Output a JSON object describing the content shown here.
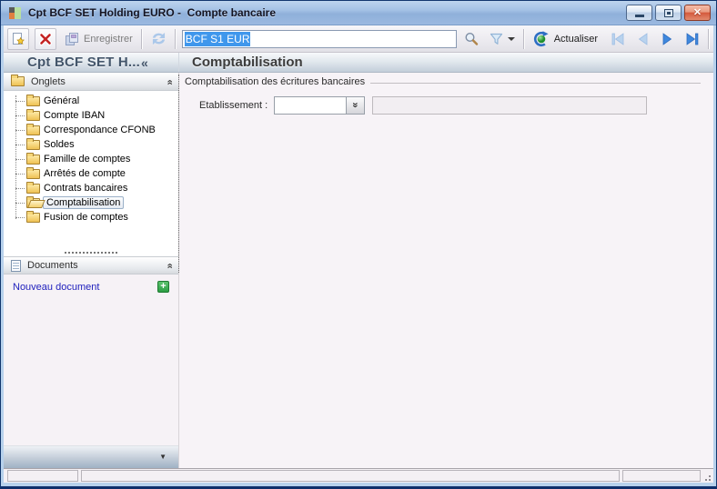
{
  "window": {
    "title": "Cpt BCF SET Holding EURO -  Compte bancaire"
  },
  "toolbar": {
    "save_label": "Enregistrer",
    "record_value": "BCF S1 EUR",
    "refresh_label": "Actualiser"
  },
  "sidebar": {
    "title": "Cpt BCF SET H...",
    "onglets": {
      "label": "Onglets",
      "items": [
        {
          "label": "Général",
          "selected": false
        },
        {
          "label": "Compte IBAN",
          "selected": false
        },
        {
          "label": "Correspondance CFONB",
          "selected": false
        },
        {
          "label": "Soldes",
          "selected": false
        },
        {
          "label": "Famille de comptes",
          "selected": false
        },
        {
          "label": "Arrêtés de compte",
          "selected": false
        },
        {
          "label": "Contrats bancaires",
          "selected": false
        },
        {
          "label": "Comptabilisation",
          "selected": true
        },
        {
          "label": "Fusion de comptes",
          "selected": false
        }
      ]
    },
    "documents": {
      "label": "Documents",
      "new_document_label": "Nouveau document"
    }
  },
  "main": {
    "title": "Comptabilisation",
    "group_label": "Comptabilisation des écritures bancaires",
    "etablissement_label": "Etablissement :",
    "etablissement_value": "",
    "detail_value": ""
  },
  "icons": {
    "sidebar_collapse": "«",
    "section_collapse": "«",
    "combo_dropdown": "«",
    "panel_collapse": "▼",
    "add": "+",
    "close": "✕"
  },
  "colors": {
    "titlebar_blue": "#8fb0da",
    "selection_blue": "#3f97ec",
    "link_blue": "#2121bd",
    "accent_green": "#2e9e44",
    "frame_blue": "#b7d1ec",
    "folder_yellow": "#efc254"
  }
}
